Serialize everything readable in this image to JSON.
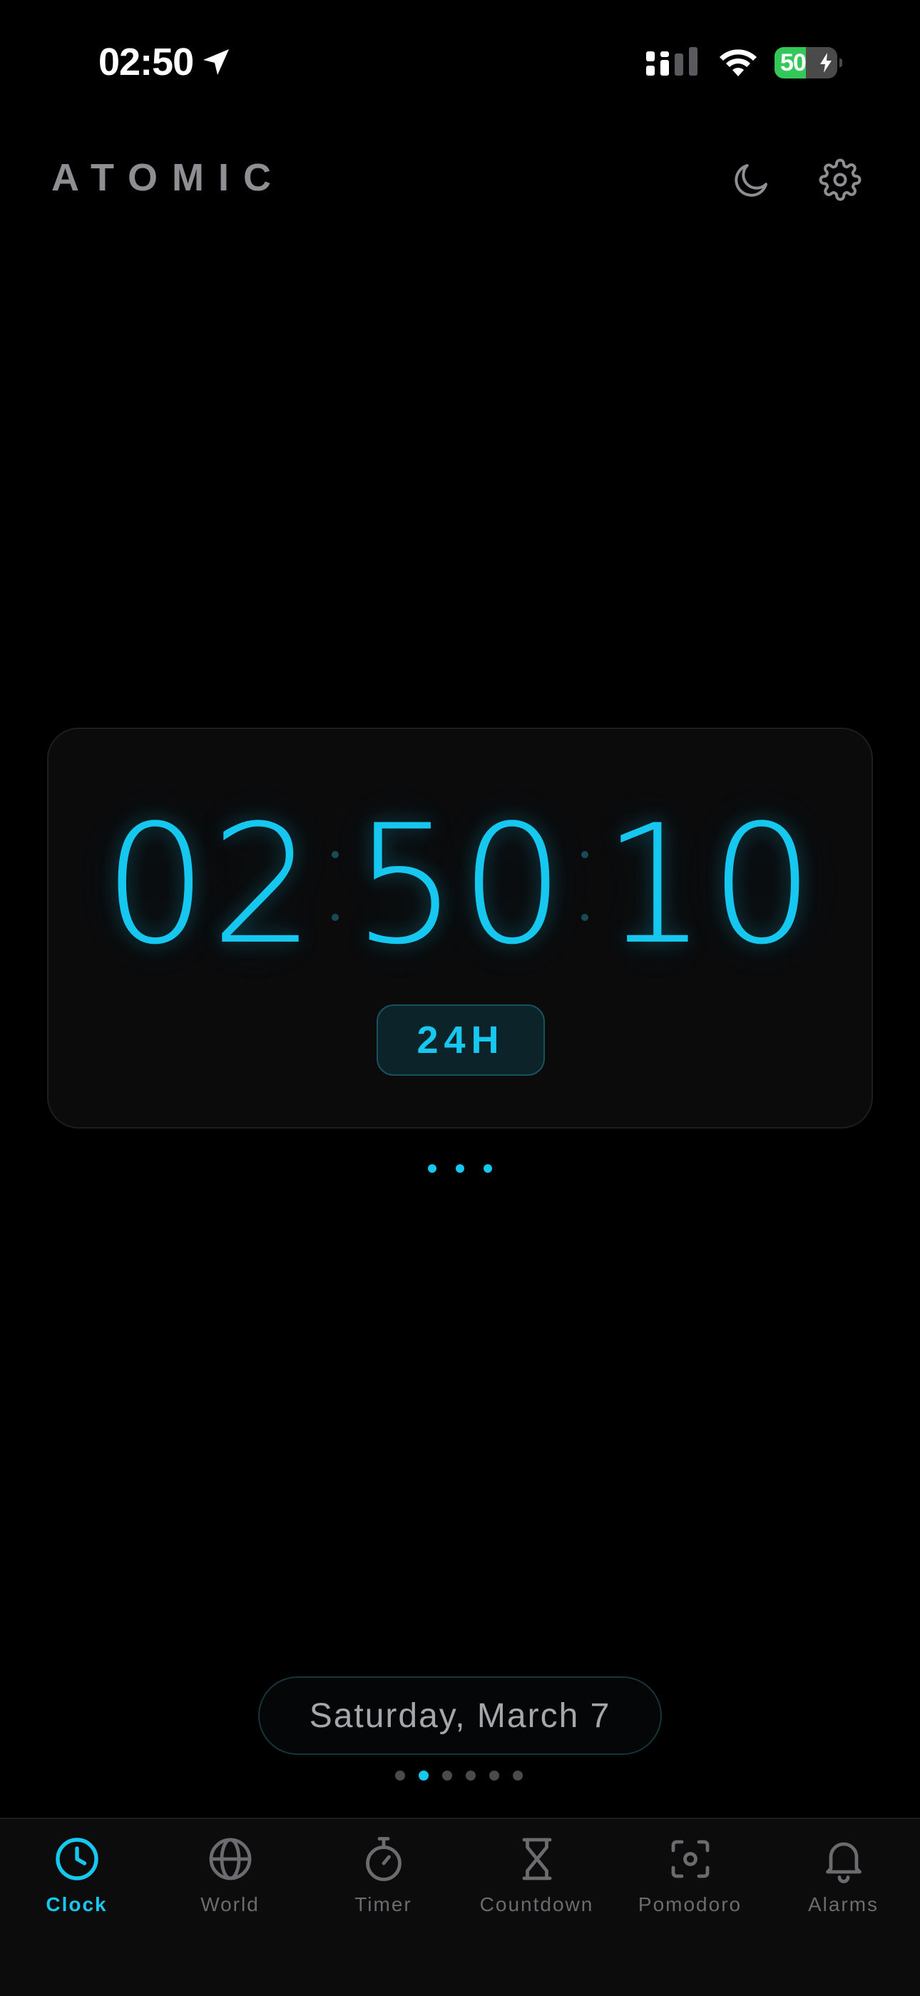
{
  "status_bar": {
    "time": "02:50",
    "battery_percent": "50",
    "battery_level": 0.5,
    "battery_fill_color": "#34c759"
  },
  "header": {
    "app_title": "ATOMIC",
    "icons": [
      "moon-icon",
      "gear-icon"
    ]
  },
  "clock": {
    "hours": "02",
    "minutes": "50",
    "seconds": "10",
    "format_label": "24H",
    "accent_color": "#16c8ef"
  },
  "date": {
    "label": "Saturday, March 7"
  },
  "pager": {
    "total": 6,
    "active_index": 1
  },
  "tabs": [
    {
      "label": "Clock",
      "icon": "clock-icon",
      "active": true
    },
    {
      "label": "World",
      "icon": "globe-icon",
      "active": false
    },
    {
      "label": "Timer",
      "icon": "stopwatch-icon",
      "active": false
    },
    {
      "label": "Countdown",
      "icon": "hourglass-icon",
      "active": false
    },
    {
      "label": "Pomodoro",
      "icon": "focus-icon",
      "active": false
    },
    {
      "label": "Alarms",
      "icon": "bell-icon",
      "active": false
    }
  ]
}
